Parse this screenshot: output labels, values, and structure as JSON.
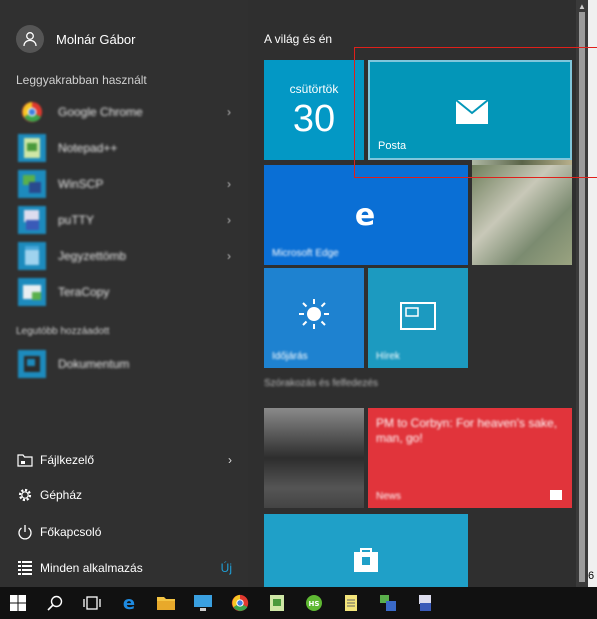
{
  "user": {
    "name": "Molnár Gábor",
    "icon": "user-icon"
  },
  "most_used": {
    "label": "Leggyakrabban használt",
    "apps": [
      {
        "name": "Google Chrome",
        "icon": "chrome-icon",
        "color": "#e0392e",
        "has_arrow": true
      },
      {
        "name": "Notepad++",
        "icon": "notepad-icon",
        "color": "#4a9a3c",
        "has_arrow": false
      },
      {
        "name": "WinSCP",
        "icon": "winscp-icon",
        "color": "#1a7bb8",
        "has_arrow": true
      },
      {
        "name": "puTTY",
        "icon": "putty-icon",
        "color": "#3a5ab8",
        "has_arrow": true
      },
      {
        "name": "Jegyzettömb",
        "icon": "notes-icon",
        "color": "#47a6d8",
        "has_arrow": true
      },
      {
        "name": "TeraCopy",
        "icon": "teracopy-icon",
        "color": "#5ab04c",
        "has_arrow": false
      }
    ]
  },
  "recent": {
    "label": "Legutóbb hozzáadott",
    "apps": [
      {
        "name": "Dokumentum",
        "icon": "app-icon",
        "color": "#1d8bbd",
        "has_arrow": false
      }
    ]
  },
  "system": {
    "file_explorer": "Fájlkezelő",
    "settings": "Gépház",
    "power": "Főkapcsoló",
    "all_apps": "Minden alkalmazás",
    "all_apps_badge": "Új"
  },
  "tiles": {
    "group1": "A világ és én",
    "group2": "Szórakozás és felfedezés",
    "calendar_day": "csütörtök",
    "calendar_date": "30",
    "mail_label": "Posta",
    "edge_label": "Microsoft Edge",
    "weather_label": "Időjárás",
    "news2_label": "Hírek",
    "news_headline": "PM to Corbyn: For heaven's sake, man, go!",
    "news_label": "News"
  },
  "edge_text": "6",
  "colors": {
    "accent": "#0398c5",
    "highlight_box": "#e0201a"
  }
}
